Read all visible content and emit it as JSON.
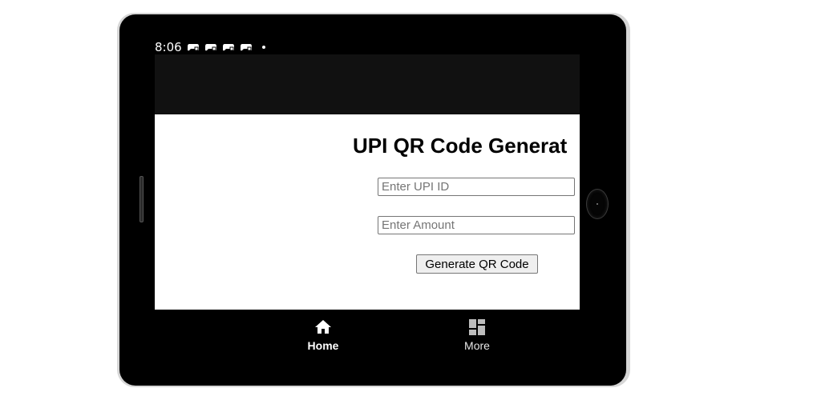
{
  "status_bar": {
    "time": "8:06",
    "icons": [
      "game-controller-icon",
      "game-controller-icon",
      "game-controller-icon",
      "game-controller-icon",
      "notification-dot"
    ]
  },
  "main": {
    "title": "UPI QR Code Generat",
    "upi_field": {
      "value": "",
      "placeholder": "Enter UPI ID"
    },
    "amount_field": {
      "value": "",
      "placeholder": "Enter Amount"
    },
    "generate_button_label": "Generate QR Code"
  },
  "bottom_nav": {
    "items": [
      {
        "label": "Home",
        "icon": "home-icon",
        "active": true
      },
      {
        "label": "More",
        "icon": "dashboard-grid-icon",
        "active": false
      }
    ]
  },
  "colors": {
    "device_frame": "#000000",
    "app_bar": "#111111",
    "screen_background": "#ffffff",
    "nav_background": "#000000",
    "nav_text": "#ffffff"
  }
}
